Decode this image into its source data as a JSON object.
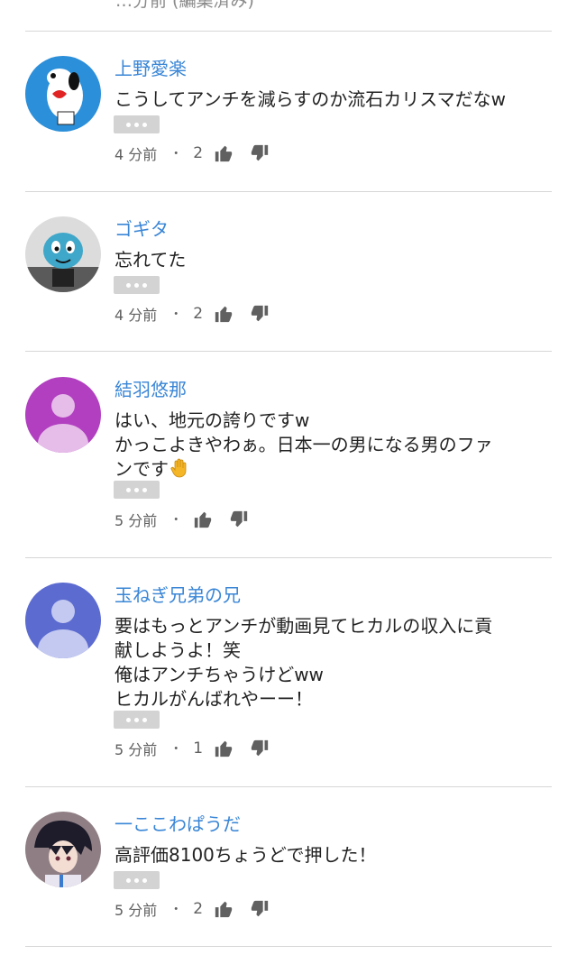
{
  "top_fragment": "…分前 (編集済み)",
  "comments": [
    {
      "username": "上野愛楽",
      "text": "こうしてアンチを減らすのか流石カリスマだなw",
      "time": "4 分前",
      "separator": "・",
      "likes": "2"
    },
    {
      "username": "ゴギタ",
      "text": "忘れてた",
      "time": "4 分前",
      "separator": "・",
      "likes": "2"
    },
    {
      "username": "結羽悠那",
      "text_lines": [
        "はい、地元の誇りですw",
        "かっこよきやわぁ。日本一の男になる男のファ",
        "ンです"
      ],
      "emoji": "raised-hand-emoji",
      "time": "5 分前",
      "separator": "・",
      "likes": ""
    },
    {
      "username": "玉ねぎ兄弟の兄",
      "text_lines": [
        "要はもっとアンチが動画見てヒカルの収入に貢",
        "献しようよ！笑",
        "俺はアンチちゃうけどww",
        "ヒカルがんばれやーー！"
      ],
      "time": "5 分前",
      "separator": "・",
      "likes": "1"
    },
    {
      "username": "一ここわぱうだ",
      "text": "高評価8100ちょうどで押した！",
      "time": "5 分前",
      "separator": "・",
      "likes": "2"
    }
  ],
  "icons": {
    "like": "thumbs-up-icon",
    "dislike": "thumbs-down-icon",
    "more": "more-options-icon"
  },
  "colors": {
    "username": "#3a86d6",
    "text": "#222222",
    "meta": "#606060",
    "divider": "#d6d6d6",
    "more_button": "#d3d3d3"
  }
}
